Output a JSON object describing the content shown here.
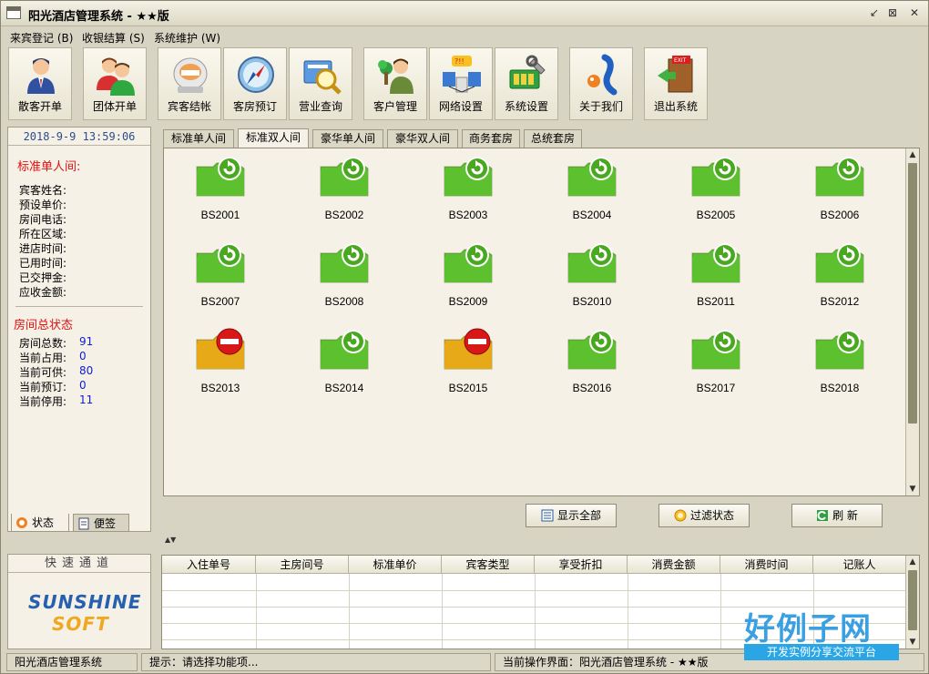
{
  "window": {
    "title": "阳光酒店管理系统 - ★★版",
    "buttons": [
      "↙",
      "⊠",
      "✕"
    ]
  },
  "menu": [
    {
      "label": "来宾登记 (B)"
    },
    {
      "label": "收银结算 (S)"
    },
    {
      "label": "系统维护 (W)"
    }
  ],
  "toolbar": [
    {
      "label": "散客开单",
      "icon": "single-guest-icon"
    },
    {
      "label": "团体开单",
      "icon": "group-guest-icon"
    },
    {
      "label": "宾客结帐",
      "icon": "checkout-icon"
    },
    {
      "label": "客房预订",
      "icon": "compass-icon"
    },
    {
      "label": "营业查询",
      "icon": "search-magnifier-icon"
    },
    {
      "label": "客户管理",
      "icon": "customer-icon"
    },
    {
      "label": "网络设置",
      "icon": "network-icon"
    },
    {
      "label": "系统设置",
      "icon": "settings-icon"
    },
    {
      "label": "关于我们",
      "icon": "about-icon"
    },
    {
      "label": "退出系统",
      "icon": "exit-door-icon"
    }
  ],
  "left": {
    "datetime": "2018-9-9  13:59:06",
    "room_section_title": "标准单人间:",
    "room_fields": [
      "宾客姓名:",
      "预设单价:",
      "房间电话:",
      "所在区域:",
      "进店时间:",
      "已用时间:",
      "已交押金:",
      "应收金额:"
    ],
    "status_title": "房间总状态",
    "status_fields": [
      {
        "label": "房间总数:",
        "value": "91"
      },
      {
        "label": "当前占用:",
        "value": "0"
      },
      {
        "label": "当前可供:",
        "value": "80"
      },
      {
        "label": "当前预订:",
        "value": "0"
      },
      {
        "label": "当前停用:",
        "value": "11"
      }
    ],
    "tabs": [
      "状态",
      "便签"
    ],
    "quick_title": "快速通道",
    "brand_line1": "SUNSHINE",
    "brand_line2": "SOFT"
  },
  "room_tabs": [
    "标准单人间",
    "标准双人间",
    "豪华单人间",
    "豪华双人间",
    "商务套房",
    "总统套房"
  ],
  "active_room_tab": 1,
  "rooms": [
    {
      "id": "BS2001",
      "status": "available"
    },
    {
      "id": "BS2002",
      "status": "available"
    },
    {
      "id": "BS2003",
      "status": "available"
    },
    {
      "id": "BS2004",
      "status": "available"
    },
    {
      "id": "BS2005",
      "status": "available"
    },
    {
      "id": "BS2006",
      "status": "available"
    },
    {
      "id": "BS2007",
      "status": "available"
    },
    {
      "id": "BS2008",
      "status": "available"
    },
    {
      "id": "BS2009",
      "status": "available"
    },
    {
      "id": "BS2010",
      "status": "available"
    },
    {
      "id": "BS2011",
      "status": "available"
    },
    {
      "id": "BS2012",
      "status": "available"
    },
    {
      "id": "BS2013",
      "status": "disabled"
    },
    {
      "id": "BS2014",
      "status": "available"
    },
    {
      "id": "BS2015",
      "status": "disabled"
    },
    {
      "id": "BS2016",
      "status": "available"
    },
    {
      "id": "BS2017",
      "status": "available"
    },
    {
      "id": "BS2018",
      "status": "available"
    }
  ],
  "actions": [
    {
      "label": "显示全部",
      "icon": "list-icon"
    },
    {
      "label": "过滤状态",
      "icon": "filter-icon"
    },
    {
      "label": "刷  新",
      "icon": "refresh-icon"
    }
  ],
  "grid_columns": [
    "入住单号",
    "主房间号",
    "标准单价",
    "宾客类型",
    "享受折扣",
    "消费金额",
    "消费时间",
    "记账人"
  ],
  "status": {
    "app_name": "阳光酒店管理系统",
    "hint": "提示：请选择功能项...",
    "current": "当前操作界面：阳光酒店管理系统 - ★★版"
  },
  "watermark": {
    "big": "好例子网",
    "small": "开发实例分享交流平台"
  },
  "colors": {
    "available": "#5cc030",
    "disabled": "#e8a818",
    "stop_sign": "#d81818",
    "accent_red": "#e01010",
    "value_blue": "#1020d0"
  }
}
